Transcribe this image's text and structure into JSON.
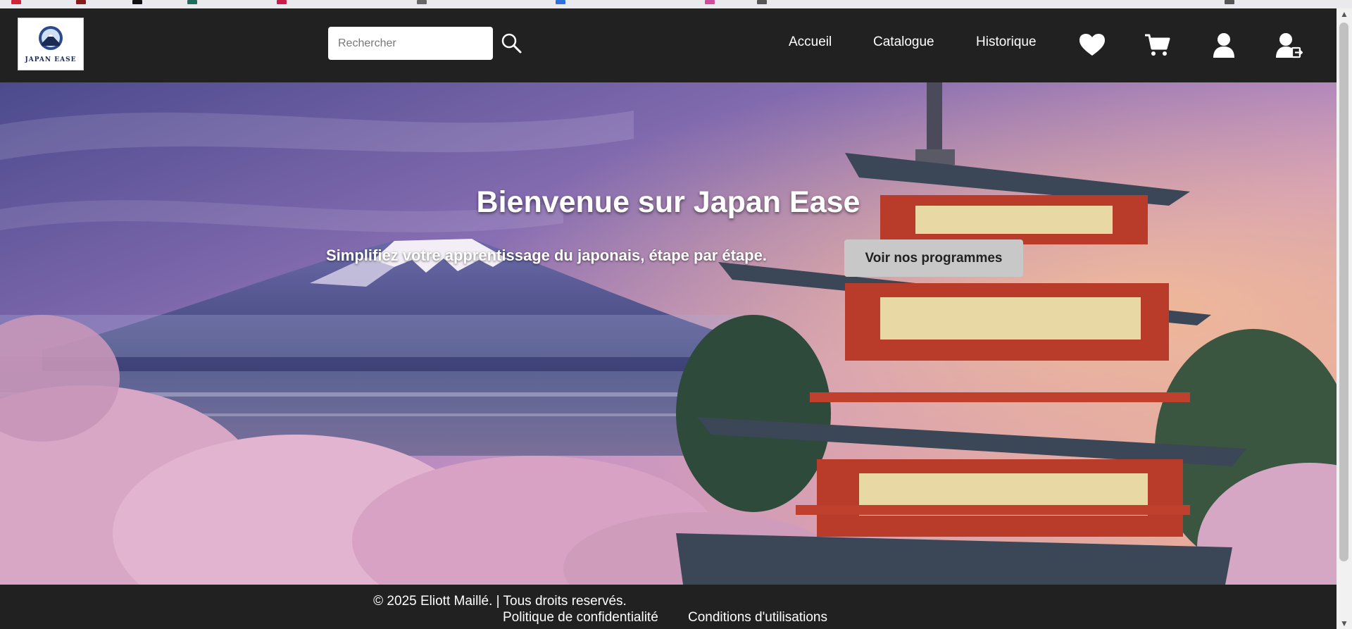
{
  "header": {
    "logo_text": "JAPAN EASE",
    "search_placeholder": "Rechercher",
    "nav": {
      "home": "Accueil",
      "catalog": "Catalogue",
      "history": "Historique"
    },
    "icons": [
      "heart-icon",
      "cart-icon",
      "user-icon",
      "logout-icon"
    ]
  },
  "hero": {
    "title": "Bienvenue sur Japan Ease",
    "subtitle": "Simplifiez votre apprentissage du japonais, étape par étape.",
    "cta": "Voir nos programmes"
  },
  "footer": {
    "copyright": "© 2025 Eliott Maillé. | Tous droits reservés.",
    "privacy": "Politique de confidentialité",
    "terms": "Conditions d'utilisations"
  },
  "colors": {
    "header_bg": "#212121",
    "button_bg": "#c8c8c8",
    "text_light": "#ffffff"
  }
}
